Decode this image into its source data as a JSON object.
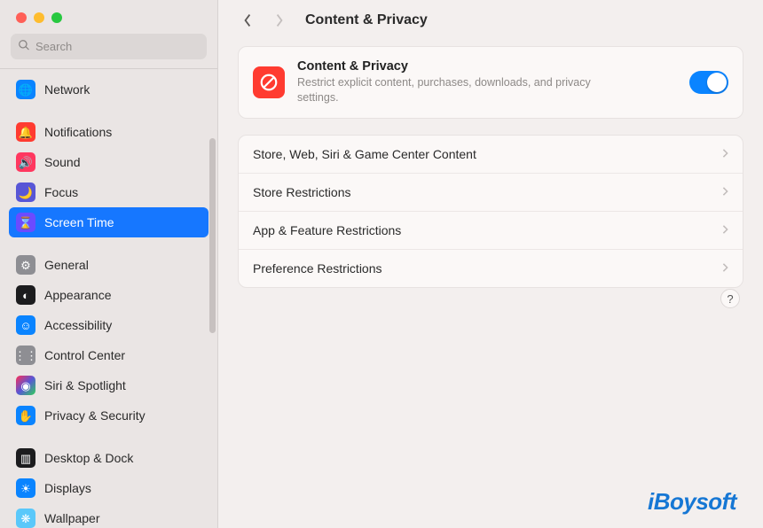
{
  "search": {
    "placeholder": "Search"
  },
  "sidebar": {
    "items": [
      {
        "label": "Network"
      },
      {
        "label": "Notifications"
      },
      {
        "label": "Sound"
      },
      {
        "label": "Focus"
      },
      {
        "label": "Screen Time"
      },
      {
        "label": "General"
      },
      {
        "label": "Appearance"
      },
      {
        "label": "Accessibility"
      },
      {
        "label": "Control Center"
      },
      {
        "label": "Siri & Spotlight"
      },
      {
        "label": "Privacy & Security"
      },
      {
        "label": "Desktop & Dock"
      },
      {
        "label": "Displays"
      },
      {
        "label": "Wallpaper"
      }
    ]
  },
  "header": {
    "title": "Content & Privacy"
  },
  "hero": {
    "title": "Content & Privacy",
    "subtitle": "Restrict explicit content, purchases, downloads, and privacy settings.",
    "toggle_on": true
  },
  "rows": [
    {
      "label": "Store, Web, Siri & Game Center Content"
    },
    {
      "label": "Store Restrictions"
    },
    {
      "label": "App & Feature Restrictions"
    },
    {
      "label": "Preference Restrictions"
    }
  ],
  "help_label": "?",
  "watermark": "iBoysoft"
}
